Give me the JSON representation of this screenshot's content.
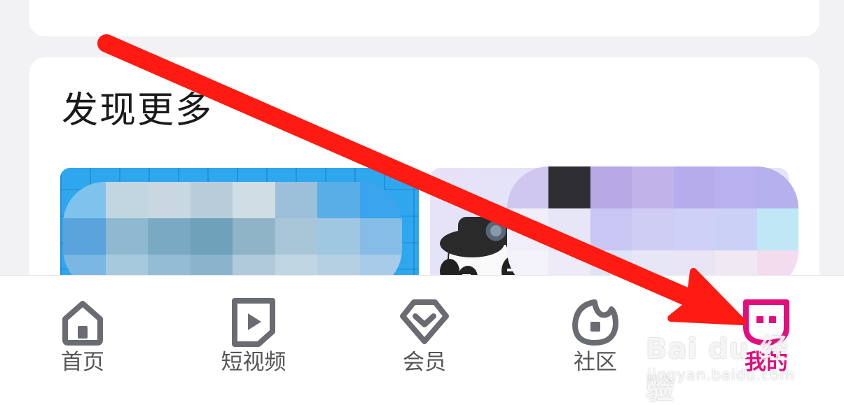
{
  "discover": {
    "title": "发现更多"
  },
  "tabbar": {
    "items": [
      {
        "label": "首页",
        "icon": "home-icon",
        "active": false
      },
      {
        "label": "短视频",
        "icon": "short-video-icon",
        "active": false
      },
      {
        "label": "会员",
        "icon": "vip-diamond-icon",
        "active": false
      },
      {
        "label": "社区",
        "icon": "community-icon",
        "active": false
      },
      {
        "label": "我的",
        "icon": "profile-icon",
        "active": true
      }
    ]
  },
  "watermark": {
    "brand": "Bai du 经验",
    "url": "jingyan.baidu.com"
  },
  "colors": {
    "accent": "#e30d7e",
    "arrow": "#ff1a12",
    "tab_icon": "#6b6c72",
    "tab_text": "#555555",
    "title_text": "#1a1a1a"
  }
}
